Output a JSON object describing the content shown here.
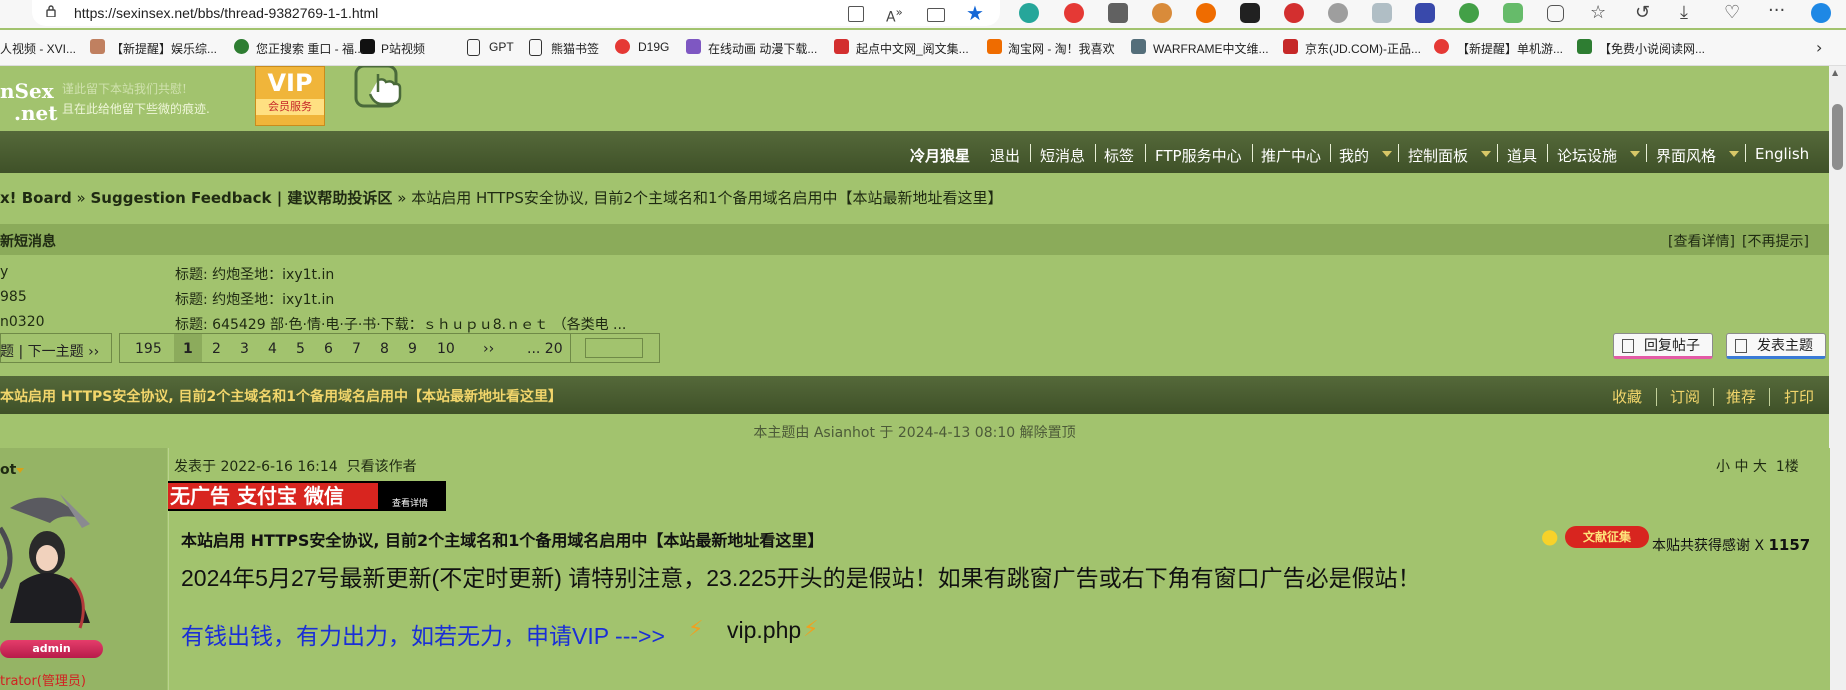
{
  "browser": {
    "url": "https://sexinsex.net/bbs/thread-9382769-1-1.html",
    "bookmarks": [
      "人视频 - XVI...",
      "【新提醒】娱乐综...",
      "您正搜索 重口 - 福...",
      "P站视频",
      "GPT",
      "熊猫书签",
      "D19G",
      "在线动画 动漫下载...",
      "起点中文网_阅文集...",
      "淘宝网 - 淘！我喜欢",
      "WARFRAME中文维...",
      "京东(JD.COM)-正品...",
      "【新提醒】单机游...",
      "【免费小说阅读网..."
    ],
    "colors": {
      "toolbar_bg": "#f7f7f7",
      "address_bg": "#ffffff",
      "star": "#1467d6"
    }
  },
  "site": {
    "logo_text": "nSex",
    "logo_text2": ".net",
    "slogan_line1": "谨此留下本站我们共慰!",
    "slogan_line2": "且在此给他留下些微的痕迹.",
    "vip_badge": "VIP",
    "vip_badge_sub": "会员服务"
  },
  "nav": {
    "items": [
      {
        "label": "冷月狼星",
        "bold": true
      },
      {
        "label": "退出"
      },
      {
        "label": "短消息"
      },
      {
        "label": "标签"
      },
      {
        "label": "FTP服务中心"
      },
      {
        "label": "推广中心"
      },
      {
        "label": "我的",
        "dropdown": true
      },
      {
        "label": "控制面板",
        "dropdown": true
      },
      {
        "label": "道具"
      },
      {
        "label": "论坛设施",
        "dropdown": true
      },
      {
        "label": "界面风格",
        "dropdown": true
      },
      {
        "label": "English"
      }
    ],
    "colors": {
      "bar": "#4b5e33",
      "text": "#ffffff",
      "caret": "#d7c767"
    }
  },
  "breadcrumb": {
    "board": "x! Board",
    "sep1": "»",
    "forum": "Suggestion Feedback | 建议帮助投诉区",
    "sep2": "»",
    "thread": "本站启用 HTTPS安全协议, 目前2个主域名和1个备用域名启用中【本站最新地址看这里】"
  },
  "pm": {
    "header": "新短消息",
    "view_details": "[查看详情]",
    "dismiss": "[不再提示]",
    "rows": [
      {
        "sender": "y",
        "title": "标题: 约炮圣地：ixy1t.in"
      },
      {
        "sender": "985",
        "title": "标题: 约炮圣地：ixy1t.in"
      },
      {
        "sender": "n0320",
        "title": "标题: 645429 部·色·情·电·子·书·下载：ｓｈｕｐｕ8.ｎｅｔ （各类电 ..."
      }
    ]
  },
  "pager": {
    "prevnext": "题 | 下一主题 ››",
    "total": "195",
    "pages": [
      "1",
      "2",
      "3",
      "4",
      "5",
      "6",
      "7",
      "8",
      "9",
      "10"
    ],
    "current": "1",
    "next": "››",
    "last": "... 20"
  },
  "actions": {
    "reply": "回复帖子",
    "new_topic": "发表主题"
  },
  "thread": {
    "title": "本站启用 HTTPS安全协议, 目前2个主域名和1个备用域名启用中【本站最新地址看这里】",
    "tools": [
      "收藏",
      "订阅",
      "推荐",
      "打印"
    ],
    "unpin_note": "本主题由 Asianhot 于 2024-4-13 08:10 解除置顶"
  },
  "post": {
    "username": "ot",
    "badge": "admin",
    "usergroup": "trator(管理员)",
    "posted": "发表于 2022-6-16 16:14",
    "only_author": "只看该作者",
    "font_small": "小",
    "font_mid": "中",
    "font_large": "大",
    "floor": "1楼",
    "banner_text": "无广告 支付宝 微信",
    "banner_sub": "查看详情",
    "title": "本站启用 HTTPS安全协议, 目前2个主域名和1个备用域名启用中【本站最新地址看这里】",
    "update_line": "2024年5月27号最新更新(不定时更新) 请特别注意，23.225开头的是假站！如果有跳窗广告或右下角有窗口广告必是假站！",
    "vip_line": "有钱出钱，有力出力，如若无力，申请VIP --->>",
    "vip_link": "vip.php",
    "thanks_label": "本贴共获得感谢 X",
    "thanks_count": "1157",
    "reward_badge": "文献征集"
  }
}
